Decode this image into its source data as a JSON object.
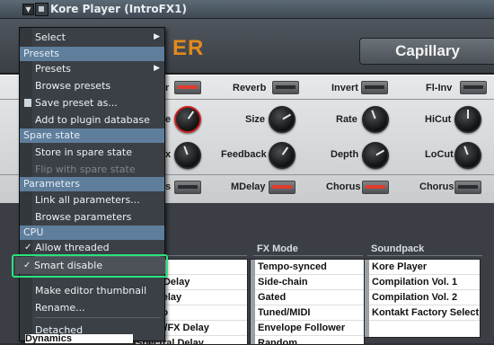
{
  "titlebar": {
    "title": "Kore Player (IntroFX1)"
  },
  "header": {
    "logo_text": "ER",
    "preset_name": "Capillary"
  },
  "panel": {
    "row1": [
      "r",
      "Reverb",
      "Invert",
      "Fl-Inv"
    ],
    "row2": [
      "e",
      "Size",
      "Rate",
      "HiCut"
    ],
    "row3": [
      "x",
      "Feedback",
      "Depth",
      "LoCut"
    ],
    "row4": [
      "s",
      "MDelay",
      "Chorus",
      "Chorus"
    ]
  },
  "lists": {
    "fx_mode_header": "FX Mode",
    "soundpack_header": "Soundpack",
    "left_items": [
      "Delay",
      "e Tap Delay",
      "Tap Delay",
      "e Echo",
      "ulated/FX Delay",
      "Spectral Delay"
    ],
    "left_partial_item": "Dynamics",
    "fx_mode_items": [
      "Tempo-synced",
      "Side-chain",
      "Gated",
      "Tuned/MIDI",
      "Envelope Follower",
      "Random"
    ],
    "soundpack_items": [
      "Kore Player",
      "Compilation Vol. 1",
      "Compilation Vol. 2",
      "Kontakt Factory Select.."
    ]
  },
  "menu": {
    "select": "Select",
    "section_presets": "Presets",
    "presets": "Presets",
    "browse_presets": "Browse presets",
    "save_preset_as": "Save preset as...",
    "add_to_database": "Add to plugin database",
    "section_spare": "Spare state",
    "store_spare": "Store in spare state",
    "flip_spare": "Flip with spare state",
    "section_parameters": "Parameters",
    "link_all": "Link all parameters...",
    "browse_parameters": "Browse parameters",
    "section_cpu": "CPU",
    "allow_threaded": "Allow threaded processing",
    "smart_disable": "Smart disable",
    "make_thumbnail": "Make editor thumbnail",
    "rename": "Rename...",
    "detached": "Detached"
  },
  "icons": [
    "dropdown-arrow-icon",
    "plugin-icon",
    "submenu-arrow-icon",
    "checkmark-icon",
    "save-icon"
  ],
  "colors": {
    "highlight": "#29e37b",
    "section_bg": "#5e7e9c",
    "logo": "#e38a1c",
    "switch_on": "#e23b2c"
  }
}
